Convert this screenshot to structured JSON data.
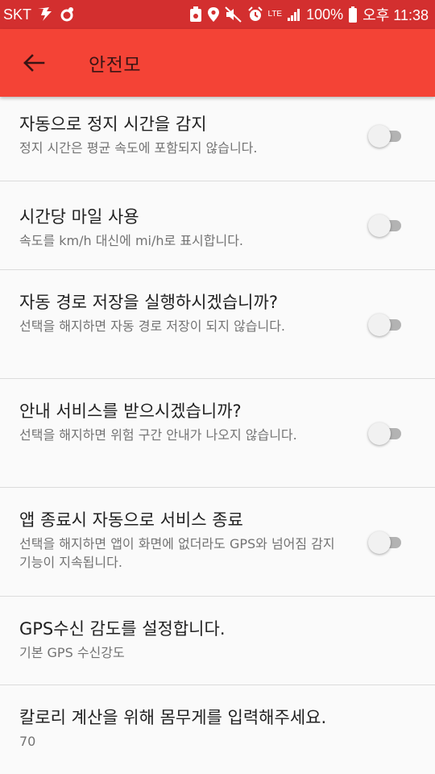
{
  "status_bar": {
    "carrier": "SKT",
    "network": "LTE",
    "battery": "100%",
    "time": "오후 11:38",
    "icons": [
      "volte-icon",
      "sync-icon",
      "recycle-icon",
      "location-icon",
      "mute-icon",
      "alarm-icon",
      "signal-icon",
      "battery-icon"
    ]
  },
  "app_bar": {
    "title": "안전모",
    "back_icon": "arrow-back-icon"
  },
  "settings": [
    {
      "title": "자동으로 정지 시간을 감지",
      "subtitle": "정지 시간은 평균 속도에 포함되지 않습니다.",
      "toggle": false
    },
    {
      "title": "시간당 마일 사용",
      "subtitle": "속도를 km/h 대신에 mi/h로 표시합니다.",
      "toggle": false
    },
    {
      "title": "자동 경로 저장을 실행하시겠습니까?",
      "subtitle": "선택을 해지하면 자동 경로 저장이 되지 않습니다.",
      "toggle": false
    },
    {
      "title": "안내 서비스를 받으시겠습니까?",
      "subtitle": "선택을 해지하면 위험 구간 안내가 나오지 않습니다.",
      "toggle": false
    },
    {
      "title": "앱 종료시 자동으로 서비스 종료",
      "subtitle": "선택을 해지하면 앱이 화면에 없더라도 GPS와 넘어짐 감지 기능이 지속됩니다.",
      "toggle": false
    },
    {
      "title": "GPS수신 감도를 설정합니다.",
      "subtitle": "기본 GPS 수신강도"
    },
    {
      "title": "칼로리 계산을 위해 몸무게를 입력해주세요.",
      "subtitle": "70"
    }
  ],
  "colors": {
    "status_bar": "#d32f2f",
    "app_bar": "#f44336",
    "background": "#fafafa",
    "toggle_track_off": "#b3b3b3",
    "toggle_thumb_off": "#f1f1f1"
  }
}
